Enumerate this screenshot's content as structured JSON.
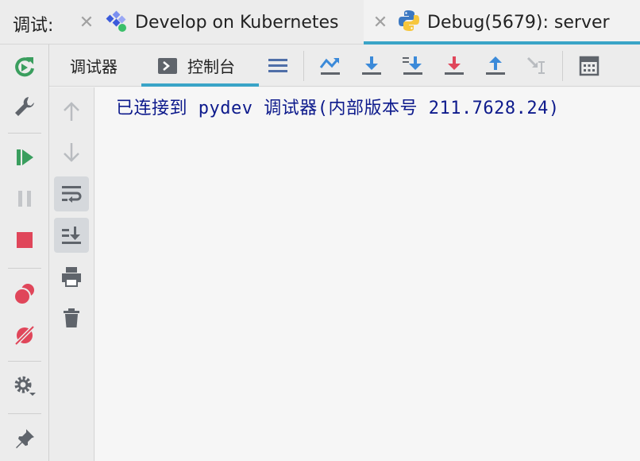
{
  "tabbar": {
    "prefix": "调试:",
    "tabs": [
      {
        "label": "Develop on Kubernetes",
        "icon": "kubernetes-run-icon",
        "active": false
      },
      {
        "label": "Debug(5679): server",
        "icon": "python-icon",
        "active": true
      }
    ]
  },
  "subtabs": [
    {
      "label": "调试器",
      "active": false
    },
    {
      "label": "控制台",
      "active": true
    }
  ],
  "console": {
    "lines": [
      "已连接到 pydev 调试器(内部版本号 211.7628.24)"
    ]
  },
  "colors": {
    "accent_underline": "#3aa4c7",
    "console_text": "#0d1a8c",
    "green": "#3a9e5e",
    "red": "#e0465a",
    "blue": "#3b8ad9"
  }
}
